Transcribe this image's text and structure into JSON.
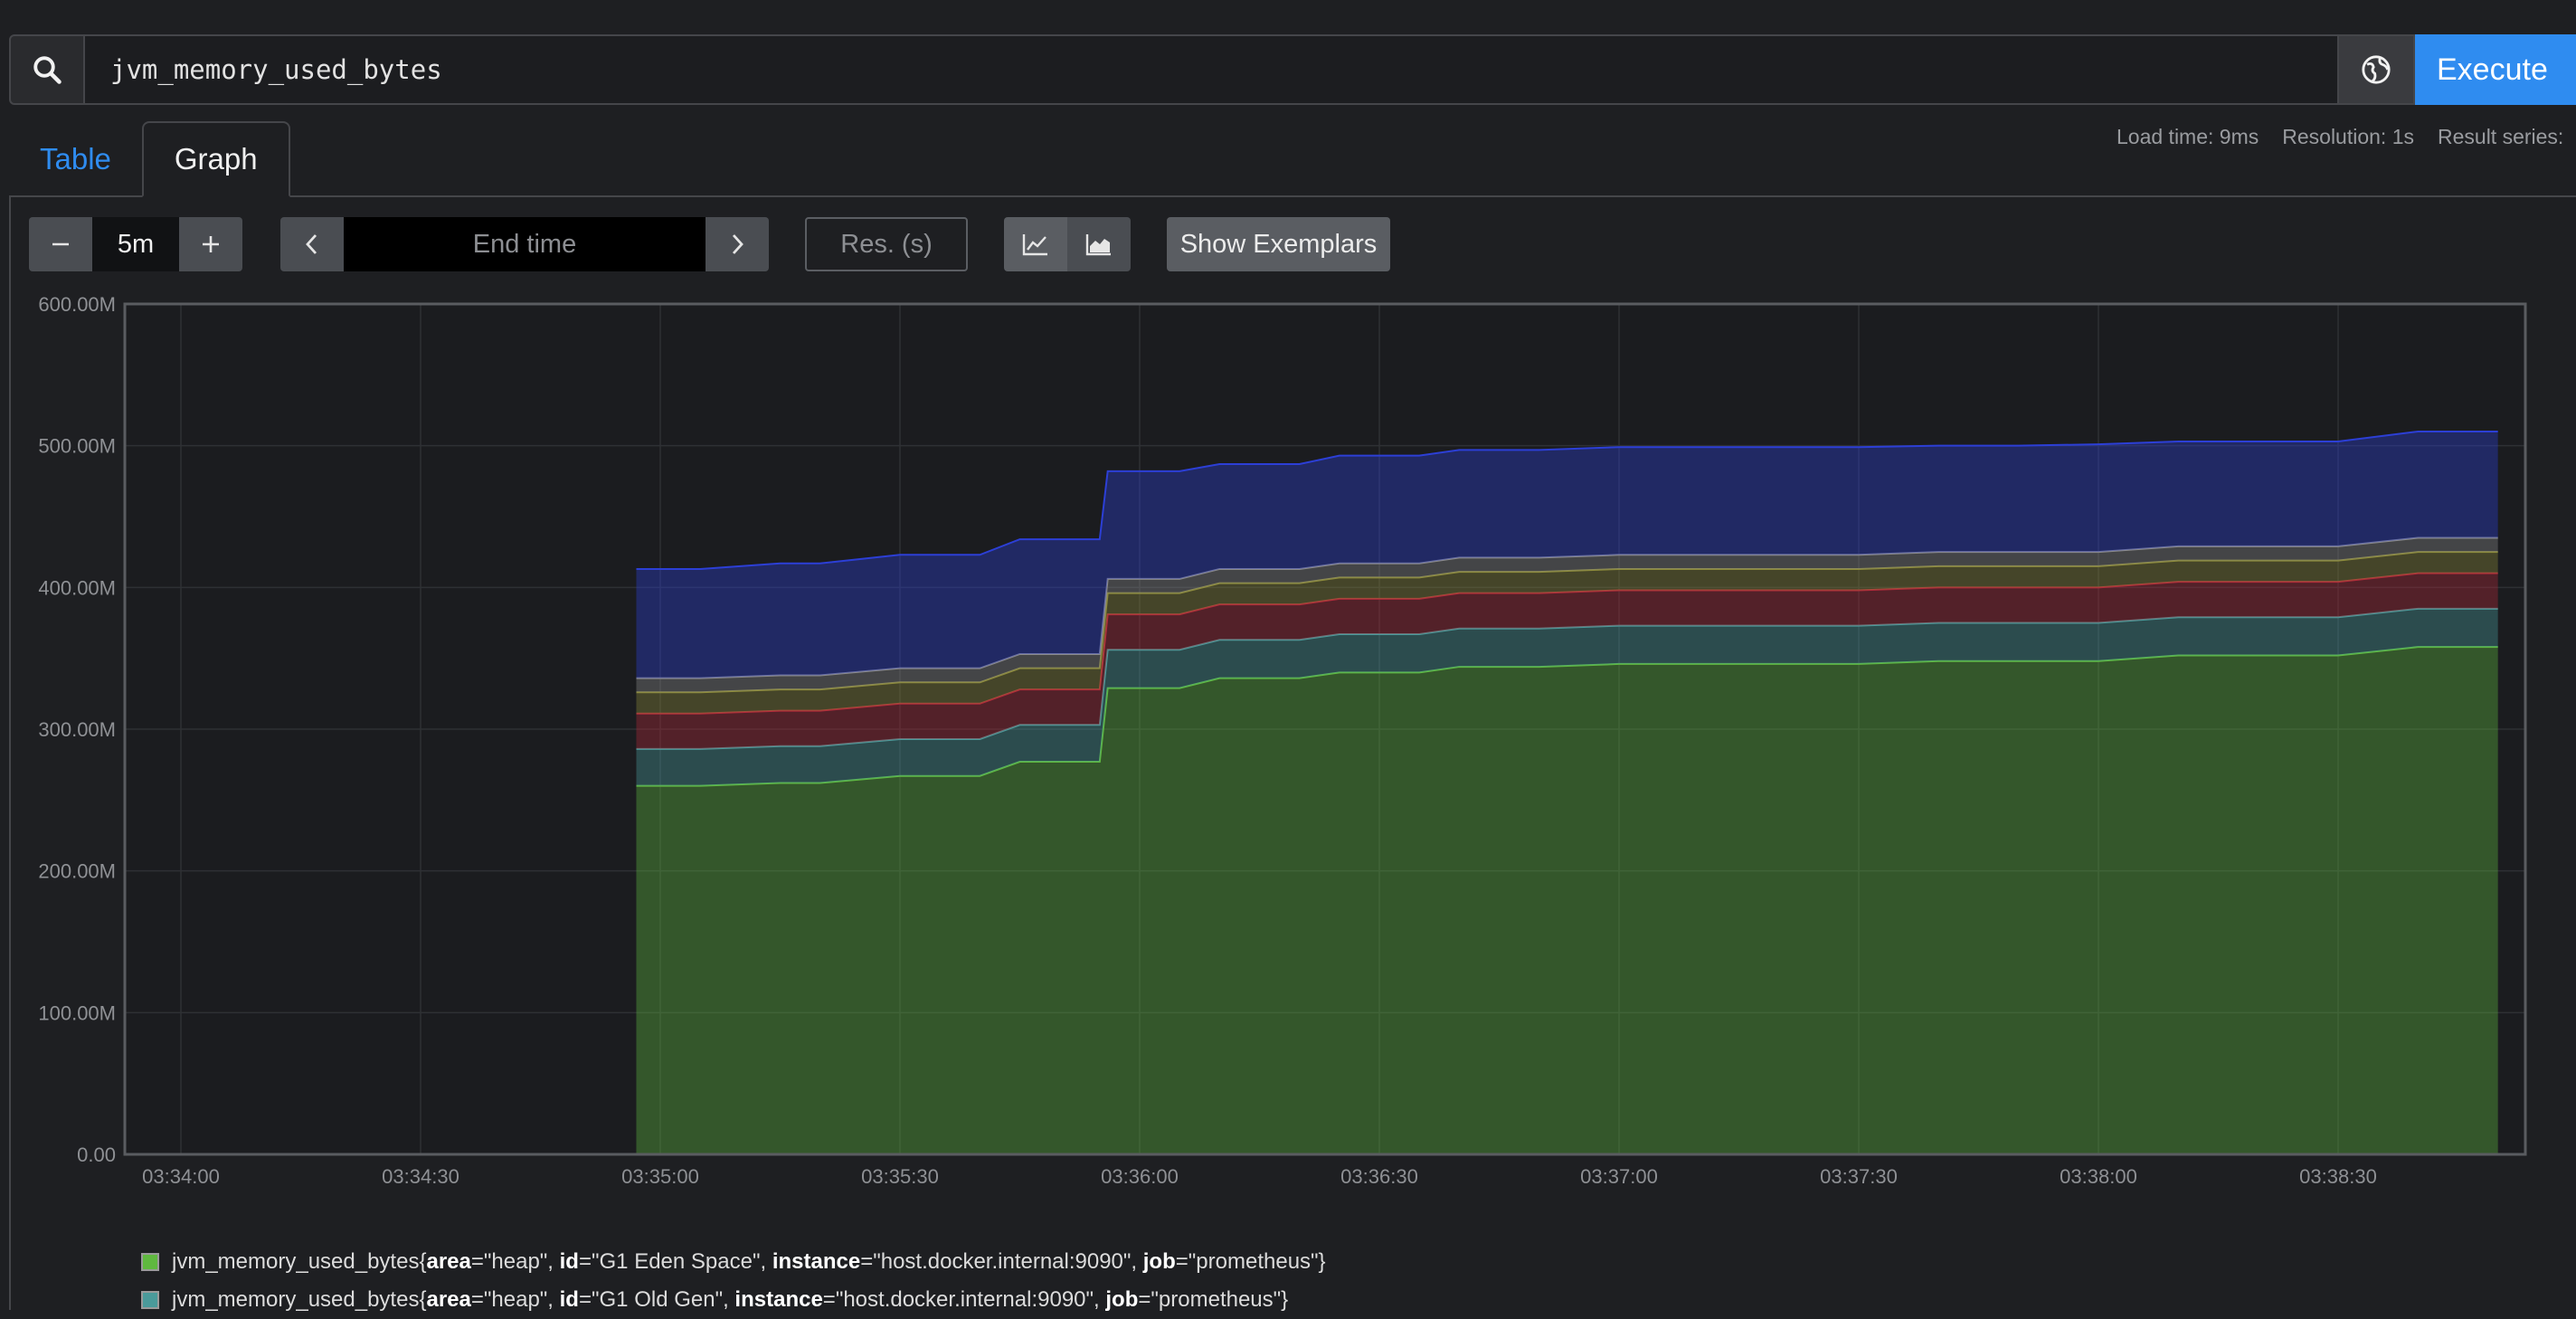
{
  "query": {
    "value": "jvm_memory_used_bytes",
    "execute_label": "Execute",
    "search_icon": "search-icon",
    "globe_icon": "globe-icon"
  },
  "tabs": [
    {
      "label": "Table"
    },
    {
      "label": "Graph"
    }
  ],
  "stats": {
    "load_time": "Load time: 9ms",
    "resolution": "Resolution: 1s",
    "result_series": "Result series:"
  },
  "controls": {
    "range": "5m",
    "end_time_placeholder": "End time",
    "res_placeholder": "Res. (s)",
    "show_exemplars": "Show Exemplars"
  },
  "chart_data": {
    "type": "area",
    "stacked": true,
    "ylim": [
      0,
      600000000
    ],
    "yticks": [
      "600.00M",
      "500.00M",
      "400.00M",
      "300.00M",
      "200.00M",
      "100.00M",
      "0.00"
    ],
    "xticks": [
      "03:34:00",
      "03:34:30",
      "03:35:00",
      "03:35:30",
      "03:36:00",
      "03:36:30",
      "03:37:00",
      "03:37:30",
      "03:38:00",
      "03:38:30"
    ],
    "grid": true,
    "x": [
      "03:34:57",
      "03:35:05",
      "03:35:15",
      "03:35:20",
      "03:35:30",
      "03:35:40",
      "03:35:45",
      "03:35:55",
      "03:35:56",
      "03:36:05",
      "03:36:10",
      "03:36:20",
      "03:36:25",
      "03:36:35",
      "03:36:40",
      "03:36:50",
      "03:37:00",
      "03:37:10",
      "03:37:20",
      "03:37:30",
      "03:37:40",
      "03:37:50",
      "03:38:00",
      "03:38:10",
      "03:38:20",
      "03:38:30",
      "03:38:40",
      "03:38:50"
    ],
    "series": [
      {
        "name": "jvm_memory_used_bytes{area=\"heap\", id=\"G1 Eden Space\", instance=\"host.docker.internal:9090\", job=\"prometheus\"}",
        "color": "#5fb83f",
        "values": [
          260000000,
          260000000,
          262000000,
          262000000,
          267000000,
          267000000,
          277000000,
          277000000,
          329000000,
          329000000,
          336000000,
          336000000,
          340000000,
          340000000,
          344000000,
          344000000,
          346000000,
          346000000,
          346000000,
          346000000,
          348000000,
          348000000,
          348000000,
          352000000,
          352000000,
          352000000,
          358000000,
          358000000
        ]
      },
      {
        "name": "jvm_memory_used_bytes{area=\"heap\", id=\"G1 Old Gen\", instance=\"host.docker.internal:9090\", job=\"prometheus\"}",
        "color": "#4a9a9a",
        "values": [
          26000000,
          26000000,
          26000000,
          26000000,
          26000000,
          26000000,
          26000000,
          26000000,
          27000000,
          27000000,
          27000000,
          27000000,
          27000000,
          27000000,
          27000000,
          27000000,
          27000000,
          27000000,
          27000000,
          27000000,
          27000000,
          27000000,
          27000000,
          27000000,
          27000000,
          27000000,
          27000000,
          27000000
        ]
      },
      {
        "name": "",
        "color": "#b02a3a",
        "values": [
          25000000,
          25000000,
          25000000,
          25000000,
          25000000,
          25000000,
          25000000,
          25000000,
          25000000,
          25000000,
          25000000,
          25000000,
          25000000,
          25000000,
          25000000,
          25000000,
          25000000,
          25000000,
          25000000,
          25000000,
          25000000,
          25000000,
          25000000,
          25000000,
          25000000,
          25000000,
          25000000,
          25000000
        ]
      },
      {
        "name": "",
        "color": "#8c8a3a",
        "values": [
          15000000,
          15000000,
          15000000,
          15000000,
          15000000,
          15000000,
          15000000,
          15000000,
          15000000,
          15000000,
          15000000,
          15000000,
          15000000,
          15000000,
          15000000,
          15000000,
          15000000,
          15000000,
          15000000,
          15000000,
          15000000,
          15000000,
          15000000,
          15000000,
          15000000,
          15000000,
          15000000,
          15000000
        ]
      },
      {
        "name": "",
        "color": "#8a8a8a",
        "values": [
          10000000,
          10000000,
          10000000,
          10000000,
          10000000,
          10000000,
          10000000,
          10000000,
          10000000,
          10000000,
          10000000,
          10000000,
          10000000,
          10000000,
          10000000,
          10000000,
          10000000,
          10000000,
          10000000,
          10000000,
          10000000,
          10000000,
          10000000,
          10000000,
          10000000,
          10000000,
          10000000,
          10000000
        ]
      },
      {
        "name": "",
        "color": "#2c3fd6",
        "values": [
          77000000,
          77000000,
          79000000,
          79000000,
          80000000,
          80000000,
          81000000,
          81000000,
          76000000,
          76000000,
          74000000,
          74000000,
          76000000,
          76000000,
          76000000,
          76000000,
          76000000,
          76000000,
          76000000,
          76000000,
          75000000,
          75000000,
          76000000,
          74000000,
          74000000,
          74000000,
          75000000,
          75000000
        ]
      }
    ]
  },
  "legend": [
    {
      "prefix": "jvm_memory_used_bytes{",
      "k1": "area",
      "v1": "=\"heap\", ",
      "k2": "id",
      "v2": "=\"G1 Eden Space\", ",
      "k3": "instance",
      "v3": "=\"host.docker.internal:9090\", ",
      "k4": "job",
      "v4": "=\"prometheus\"}",
      "color": "#5fb83f"
    },
    {
      "prefix": "jvm_memory_used_bytes{",
      "k1": "area",
      "v1": "=\"heap\", ",
      "k2": "id",
      "v2": "=\"G1 Old Gen\", ",
      "k3": "instance",
      "v3": "=\"host.docker.internal:9090\", ",
      "k4": "job",
      "v4": "=\"prometheus\"}",
      "color": "#4a9a9a"
    }
  ]
}
